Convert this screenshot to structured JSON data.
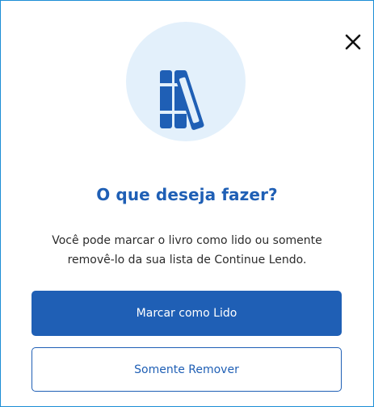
{
  "dialog": {
    "title": "O que deseja fazer?",
    "message_line1": "Você pode marcar o livro como lido ou somente",
    "message_line2": "removê-lo da sua lista de Continue Lendo.",
    "primary_button_label": "Marcar como Lido",
    "secondary_button_label": "Somente Remover",
    "close_icon": "close-icon",
    "illustration_icon": "books-icon"
  },
  "colors": {
    "accent": "#1f5fb5",
    "illustration_bg": "#e3f0fb",
    "frame_border": "#1c8ed6",
    "text": "#2b2b2b"
  }
}
